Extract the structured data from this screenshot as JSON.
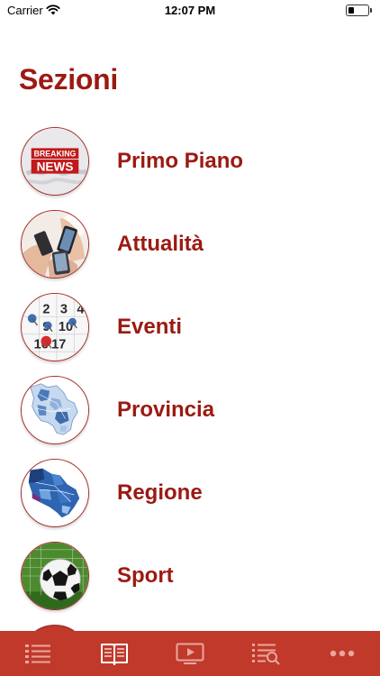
{
  "status_bar": {
    "carrier": "Carrier",
    "time": "12:07 PM",
    "icons": [
      "wifi-icon",
      "battery-icon"
    ]
  },
  "page": {
    "title": "Sezioni"
  },
  "sections": [
    {
      "label": "Primo Piano",
      "thumbnail_text_1": "BREAKING",
      "thumbnail_text_2": "NEWS",
      "thumbnail": "breaking-news-thumbnail"
    },
    {
      "label": "Attualità",
      "thumbnail": "smartphones-thumbnail"
    },
    {
      "label": "Eventi",
      "thumbnail": "calendar-thumbnail",
      "calendar_numbers": [
        "2",
        "3",
        "4",
        "9",
        "10",
        "16",
        "17"
      ]
    },
    {
      "label": "Provincia",
      "thumbnail": "province-map-thumbnail"
    },
    {
      "label": "Regione",
      "thumbnail": "region-map-thumbnail"
    },
    {
      "label": "Sport",
      "thumbnail": "soccer-ball-thumbnail"
    }
  ],
  "tab_bar": {
    "background": "#c0392b",
    "tabs": [
      {
        "icon": "list-icon",
        "selected": false
      },
      {
        "icon": "book-icon",
        "selected": true
      },
      {
        "icon": "video-icon",
        "selected": false
      },
      {
        "icon": "search-list-icon",
        "selected": false
      },
      {
        "icon": "more-icon",
        "selected": false
      }
    ]
  },
  "colors": {
    "accent": "#9b1a12",
    "tab_bar": "#c0392b",
    "tab_icon": "#e8a79f",
    "tab_icon_selected": "#ffffff"
  }
}
